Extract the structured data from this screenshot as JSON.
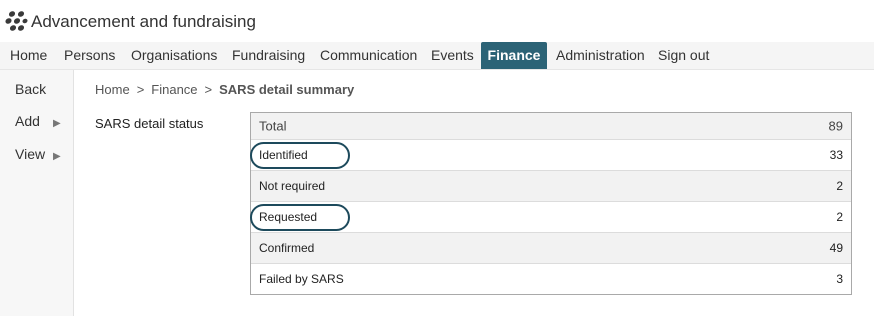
{
  "app": {
    "title": "Advancement and fundraising",
    "logo_icon": "paw-print-icon"
  },
  "nav": {
    "items": [
      {
        "label": "Home"
      },
      {
        "label": "Persons"
      },
      {
        "label": "Organisations"
      },
      {
        "label": "Fundraising"
      },
      {
        "label": "Communication"
      },
      {
        "label": "Events"
      },
      {
        "label": "Finance",
        "active": true
      },
      {
        "label": "Administration"
      },
      {
        "label": "Sign out"
      }
    ],
    "active_color": "#2c6376"
  },
  "sidebar": {
    "items": [
      {
        "label": "Back"
      },
      {
        "label": "Add",
        "arrow": "▶"
      },
      {
        "label": "View",
        "arrow": "▶"
      }
    ]
  },
  "breadcrumb": {
    "items": [
      "Home",
      "Finance"
    ],
    "separator": ">",
    "current": "SARS detail summary"
  },
  "summary": {
    "label": "SARS detail status",
    "rows": [
      {
        "label": "Total",
        "value": "89"
      },
      {
        "label": "Identified",
        "value": "33",
        "highlighted": true
      },
      {
        "label": "Not required",
        "value": "2"
      },
      {
        "label": "Requested",
        "value": "2",
        "highlighted": true
      },
      {
        "label": "Confirmed",
        "value": "49"
      },
      {
        "label": "Failed by SARS",
        "value": "3"
      }
    ],
    "highlight_color": "#1d4a5c"
  }
}
